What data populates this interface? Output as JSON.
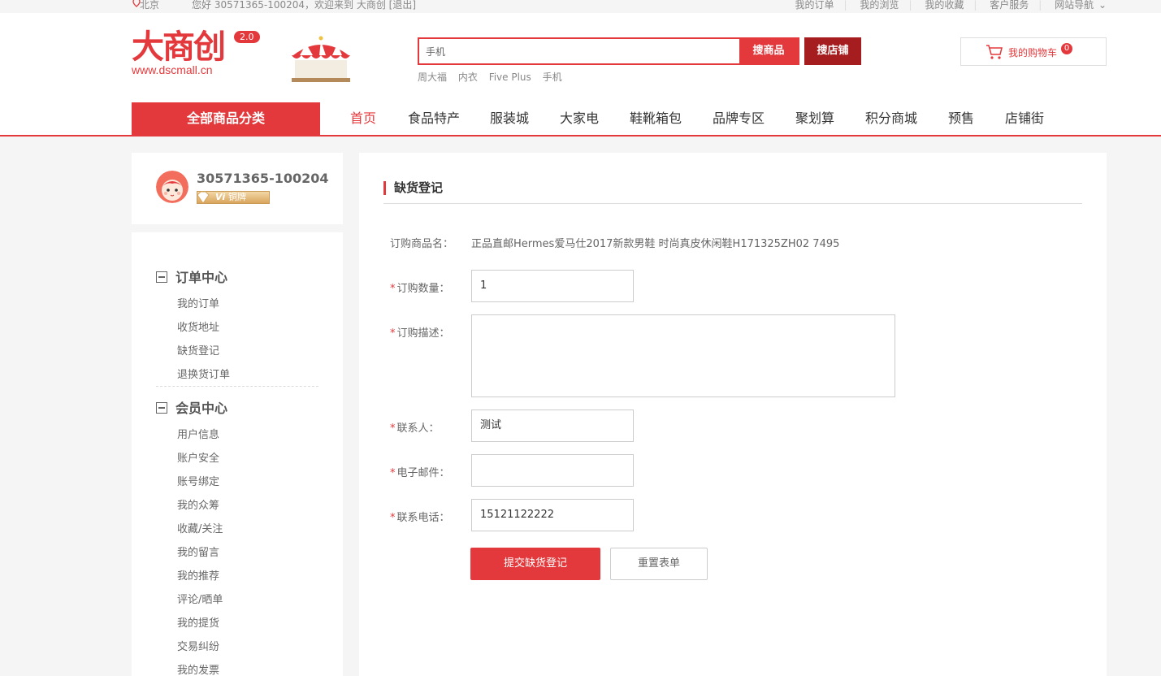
{
  "topbar": {
    "city": "北京",
    "greeting": "您好 30571365-100204，欢迎来到 大商创 [退出]",
    "links": [
      "我的订单",
      "我的浏览",
      "我的收藏",
      "客户服务",
      "网站导航"
    ]
  },
  "header": {
    "logo_text": "大商创",
    "logo_version": "2.0",
    "logo_url": "www.dscmall.cn",
    "search_value": "手机",
    "search_goods_label": "搜商品",
    "search_shop_label": "搜店铺",
    "hot_words": [
      "周大福",
      "内衣",
      "Five Plus",
      "手机"
    ],
    "cart_label": "我的购物车",
    "cart_count": "0"
  },
  "nav": {
    "all_categories": "全部商品分类",
    "items": [
      "首页",
      "食品特产",
      "服装城",
      "大家电",
      "鞋靴箱包",
      "品牌专区",
      "聚划算",
      "积分商城",
      "预售",
      "店铺街"
    ]
  },
  "user": {
    "name": "30571365-100204",
    "rank_prefix": "Vi",
    "rank": "铜牌"
  },
  "sidebar": {
    "sections": [
      {
        "title": "订单中心",
        "items": [
          "我的订单",
          "收货地址",
          "缺货登记",
          "退换货订单"
        ]
      },
      {
        "title": "会员中心",
        "items": [
          "用户信息",
          "账户安全",
          "账号绑定",
          "我的众筹",
          "收藏/关注",
          "我的留言",
          "我的推荐",
          "评论/晒单",
          "我的提货",
          "交易纠纷",
          "我的发票"
        ]
      }
    ]
  },
  "form": {
    "title": "缺货登记",
    "product_label": "订购商品名：",
    "product_value": "正品直邮Hermes爱马仕2017新款男鞋 时尚真皮休闲鞋H171325ZH02 7495",
    "required_mark": "*",
    "qty_label": "订购数量：",
    "qty_value": "1",
    "desc_label": "订购描述：",
    "desc_value": "",
    "contact_label": "联系人：",
    "contact_value": "测试",
    "email_label": "电子邮件：",
    "email_value": "",
    "phone_label": "联系电话：",
    "phone_value": "15121122222",
    "submit_label": "提交缺货登记",
    "reset_label": "重置表单"
  },
  "colors": {
    "brand": "#e4393c",
    "brand_dark": "#a61d1f"
  }
}
